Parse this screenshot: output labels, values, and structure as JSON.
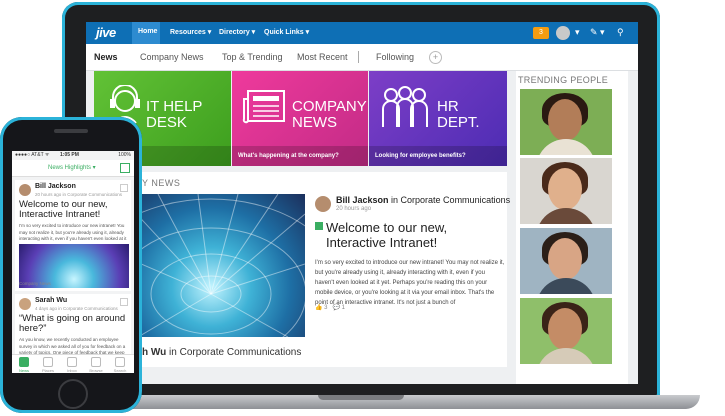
{
  "desktop": {
    "logo": "jive",
    "top_nav": [
      "Home",
      "Resources ▾",
      "Directory ▾",
      "Quick Links ▾"
    ],
    "notification_count": "3",
    "tabs": [
      "News",
      "Company News",
      "Top & Trending",
      "Most Recent",
      "Following"
    ],
    "tiles": [
      {
        "title": "IT HELP\nDESK",
        "footer": "ct to the VPN?"
      },
      {
        "title": "COMPANY\nNEWS",
        "footer": "What's happening at the company?"
      },
      {
        "title": "HR\nDEPT.",
        "footer": "Looking for employee benefits?"
      }
    ],
    "news_label": "Y NEWS",
    "post": {
      "author": "Bill Jackson",
      "place": " in Corporate Communications",
      "time": "20 hours ago",
      "title": "Welcome to our new, Interactive Intranet!",
      "body": "I'm so very excited to introduce our new intranet! You may not realize it, but you're already using it, already interacting with it, even if you haven't even looked at it yet. Perhaps you're reading this on your mobile device, or you're looking at it via your email inbox. That's the point of an interactive intranet. It's not just a bunch of",
      "likes": "3",
      "comments": "1"
    },
    "post2": {
      "author": "h Wu",
      "place": " in Corporate Communications"
    },
    "trending_label": "TRENDING PEOPLE",
    "colors": {
      "nav": "#0e6fb5",
      "it": "#62c236",
      "company": "#ef3a9c",
      "hr": "#7d3ec7"
    }
  },
  "phone": {
    "status": {
      "carrier": "●●●●○ AT&T ᯤ",
      "time": "1:05 PM",
      "battery": "100%"
    },
    "header": "News Highlights ▾",
    "cards": [
      {
        "author": "Bill Jackson",
        "sub": "20 hours ago in Corporate Communications",
        "title": "Welcome to our new, Interactive Intranet!",
        "body": "I'm so very excited to introduce our new intranet! You may not realize it, but you're already using it, already interacting with it, even if you haven't even looked at it yet.",
        "tag": "Company News"
      },
      {
        "author": "Sarah Wu",
        "sub": "4 days ago in Corporate Communications",
        "title": "“What is going on around here?”",
        "body": "As you know, we recently conducted an employee survey in which we asked all of you for feedback on a variety of topics. One piece of feedback that we keep"
      }
    ],
    "tabs": [
      "News",
      "Places",
      "Inbox",
      "Browse",
      "Search"
    ]
  }
}
